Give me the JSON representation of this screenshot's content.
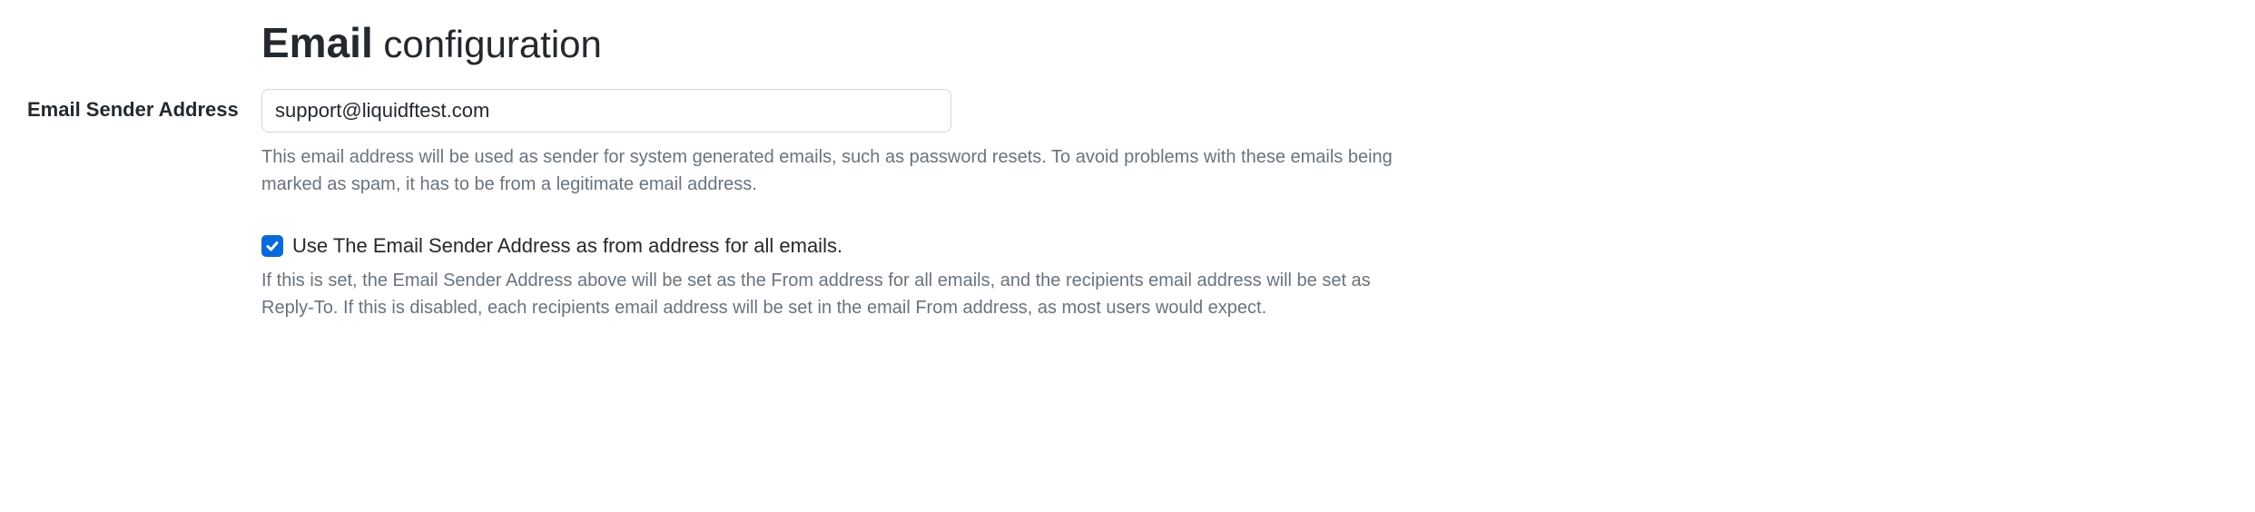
{
  "heading": {
    "bold": "Email",
    "regular": " configuration"
  },
  "sender": {
    "label": "Email Sender Address",
    "value": "support@liquidftest.com",
    "help": "This email address will be used as sender for system generated emails, such as password resets. To avoid problems with these emails being marked as spam, it has to be from a legitimate email address."
  },
  "use_as_from": {
    "checked": true,
    "label": "Use The Email Sender Address as from address for all emails.",
    "help": "If this is set, the Email Sender Address above will be set as the From address for all emails, and the recipients email address will be set as Reply-To. If this is disabled, each recipients email address will be set in the email From address, as most users would expect."
  }
}
